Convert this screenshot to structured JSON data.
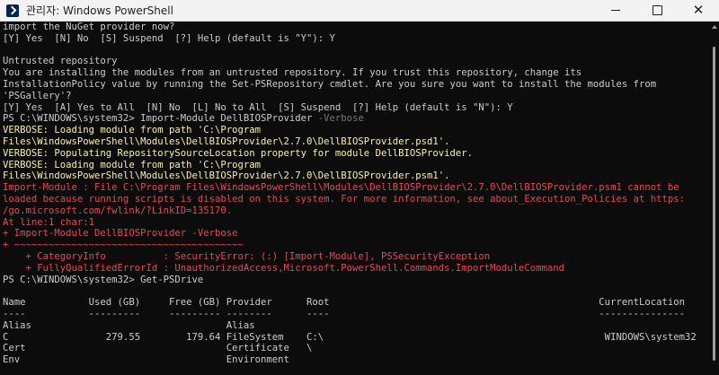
{
  "window": {
    "title": "관리자: Windows PowerShell",
    "icon": "powershell-icon",
    "colors": {
      "background": "#0c0c0c",
      "text": "#cccccc",
      "verbose": "#f9f1a5",
      "error": "#e74856",
      "parameter": "#767676"
    }
  },
  "console": {
    "lines": [
      {
        "segments": [
          {
            "text": "import the NuGet provider now?",
            "color": "default"
          }
        ]
      },
      {
        "segments": [
          {
            "text": "[Y] Yes  [N] No  [S] Suspend  [?] Help (default is \"Y\"): Y",
            "color": "default"
          }
        ]
      },
      {
        "segments": [
          {
            "text": "",
            "color": "default"
          }
        ]
      },
      {
        "segments": [
          {
            "text": "Untrusted repository",
            "color": "default"
          }
        ]
      },
      {
        "segments": [
          {
            "text": "You are installing the modules from an untrusted repository. If you trust this repository, change its",
            "color": "default"
          }
        ]
      },
      {
        "segments": [
          {
            "text": "InstallationPolicy value by running the Set-PSRepository cmdlet. Are you sure you want to install the modules from",
            "color": "default"
          }
        ]
      },
      {
        "segments": [
          {
            "text": "'PSGallery'?",
            "color": "default"
          }
        ]
      },
      {
        "segments": [
          {
            "text": "[Y] Yes  [A] Yes to All  [N] No  [L] No to All  [S] Suspend  [?] Help (default is \"N\"): Y",
            "color": "default"
          }
        ]
      },
      {
        "segments": [
          {
            "text": "PS C:\\WINDOWS\\system32> Import-Module DellBIOSProvider ",
            "color": "default"
          },
          {
            "text": "-Verbose",
            "color": "gray"
          }
        ]
      },
      {
        "segments": [
          {
            "text": "VERBOSE: Loading module from path 'C:\\Program",
            "color": "yellow"
          }
        ]
      },
      {
        "segments": [
          {
            "text": "Files\\WindowsPowerShell\\Modules\\DellBIOSProvider\\2.7.0\\DellBIOSProvider.psd1'.",
            "color": "yellow"
          }
        ]
      },
      {
        "segments": [
          {
            "text": "VERBOSE: Populating RepositorySourceLocation property for module DellBIOSProvider.",
            "color": "yellow"
          }
        ]
      },
      {
        "segments": [
          {
            "text": "VERBOSE: Loading module from path 'C:\\Program",
            "color": "yellow"
          }
        ]
      },
      {
        "segments": [
          {
            "text": "Files\\WindowsPowerShell\\Modules\\DellBIOSProvider\\2.7.0\\DellBIOSProvider.psm1'.",
            "color": "yellow"
          }
        ]
      },
      {
        "segments": [
          {
            "text": "Import-Module : File C:\\Program Files\\WindowsPowerShell\\Modules\\DellBIOSProvider\\2.7.0\\DellBIOSProvider.psm1 cannot be",
            "color": "red"
          }
        ]
      },
      {
        "segments": [
          {
            "text": "loaded because running scripts is disabled on this system. For more information, see about_Execution_Policies at https:",
            "color": "red"
          }
        ]
      },
      {
        "segments": [
          {
            "text": "/go.microsoft.com/fwlink/?LinkID=135170.",
            "color": "red"
          }
        ]
      },
      {
        "segments": [
          {
            "text": "At line:1 char:1",
            "color": "red"
          }
        ]
      },
      {
        "segments": [
          {
            "text": "+ Import-Module DellBIOSProvider -Verbose",
            "color": "red"
          }
        ]
      },
      {
        "segments": [
          {
            "text": "+ ~~~~~~~~~~~~~~~~~~~~~~~~~~~~~~~~~~~~~~~~",
            "color": "red"
          }
        ]
      },
      {
        "segments": [
          {
            "text": "    + CategoryInfo          : SecurityError: (:) [Import-Module], PSSecurityException",
            "color": "red"
          }
        ]
      },
      {
        "segments": [
          {
            "text": "    + FullyQualifiedErrorId : UnauthorizedAccess,Microsoft.PowerShell.Commands.ImportModuleCommand",
            "color": "red"
          }
        ]
      },
      {
        "segments": [
          {
            "text": "PS C:\\WINDOWS\\system32> Get-PSDrive",
            "color": "default"
          }
        ]
      },
      {
        "segments": [
          {
            "text": "",
            "color": "default"
          }
        ]
      },
      {
        "segments": [
          {
            "text": "Name           Used (GB)     Free (GB) Provider      Root                                               CurrentLocation",
            "color": "default"
          }
        ]
      },
      {
        "segments": [
          {
            "text": "----           ---------     --------- --------      ----                                               ---------------",
            "color": "default"
          }
        ]
      },
      {
        "segments": [
          {
            "text": "Alias                                  Alias",
            "color": "default"
          }
        ]
      },
      {
        "segments": [
          {
            "text": "C                 279.55        179.64 FileSystem    C:\\                                                 WINDOWS\\system32",
            "color": "default"
          }
        ]
      },
      {
        "segments": [
          {
            "text": "Cert                                   Certificate   \\",
            "color": "default"
          }
        ]
      },
      {
        "segments": [
          {
            "text": "Env                                    Environment",
            "color": "default"
          }
        ]
      }
    ]
  }
}
